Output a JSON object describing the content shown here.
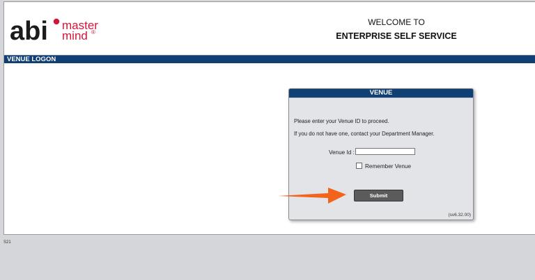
{
  "header": {
    "logo": {
      "brand": "abi",
      "line1": "master",
      "line2": "mind",
      "mark": "®"
    },
    "welcome_line1": "WELCOME TO",
    "welcome_line2": "ENTERPRISE SELF SERVICE"
  },
  "banner": {
    "title": "VENUE LOGON"
  },
  "panel": {
    "title": "VENUE",
    "message1": "Please enter your Venue ID to proceed.",
    "message2": "If you do not have one, contact your Department Manager.",
    "venue_label": "Venue Id :",
    "venue_value": "",
    "remember_label": "Remember Venue",
    "remember_checked": false,
    "submit_label": "Submit",
    "version": "(sv6.32.00)"
  },
  "footer": {
    "code": "S21"
  },
  "colors": {
    "brand_red": "#d5143a",
    "navy": "#0f3f73",
    "button": "#5b5b5b",
    "arrow": "#f2641c"
  },
  "icons": [
    "abi-mastermind-logo",
    "orange-arrow-icon",
    "checkbox-icon"
  ]
}
